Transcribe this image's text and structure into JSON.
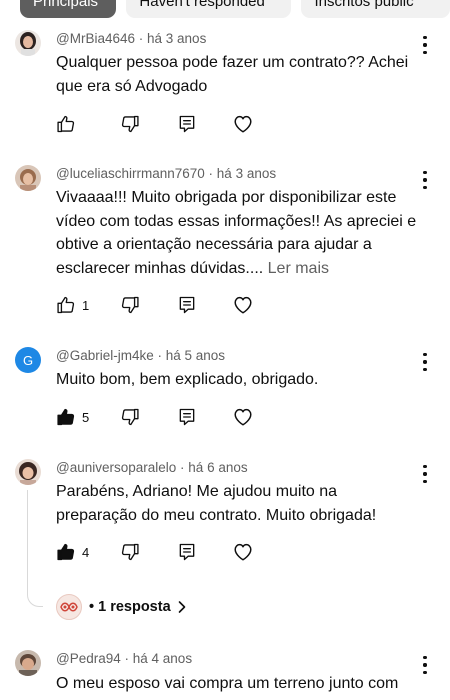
{
  "tabs": [
    {
      "label": "Principais",
      "active": true
    },
    {
      "label": "Haven't responded",
      "active": false
    },
    {
      "label": "Inscritos públic",
      "active": false
    }
  ],
  "comments": [
    {
      "author": "@MrBia4646",
      "time": "há 3 anos",
      "text": "Qualquer pessoa pode fazer um contrato?? Achei que era só Advogado",
      "more": "",
      "likes": "",
      "liked": false
    },
    {
      "author": "@luceliaschirrmann7670",
      "time": "há 3 anos",
      "text": "Vivaaaa!!! Muito obrigada por disponibilizar este vídeo com todas essas informações!! As apreciei e obtive a orientação necessária para ajudar a esclarecer minhas dúvidas....",
      "more": "Ler mais",
      "likes": "1",
      "liked": false
    },
    {
      "author": "@Gabriel-jm4ke",
      "time": "há 5 anos",
      "text": "Muito bom, bem explicado, obrigado.",
      "more": "",
      "likes": "5",
      "liked": true,
      "avatar_letter": "G"
    },
    {
      "author": "@auniversoparalelo",
      "time": "há 6 anos",
      "text": "Parabéns, Adriano! Me ajudou muito na preparação do meu contrato. Muito obrigada!",
      "more": "",
      "likes": "4",
      "liked": true,
      "reply_label": "• 1 resposta"
    },
    {
      "author": "@Pedra94",
      "time": "há 4 anos",
      "text": "O meu esposo vai compra um terreno junto com",
      "more": "",
      "likes": "",
      "liked": false
    }
  ],
  "icons": {
    "like": "thumbs-up-icon",
    "dislike": "thumbs-down-icon",
    "reply": "reply-comment-icon",
    "heart": "heart-icon",
    "more": "more-vertical-icon",
    "chevron": "chevron-right-icon"
  },
  "colors": {
    "active_tab": "#5e5e5e",
    "inactive_tab": "#f1f1f1",
    "meta_text": "#606060",
    "avatar_g": "#1e88e5"
  }
}
